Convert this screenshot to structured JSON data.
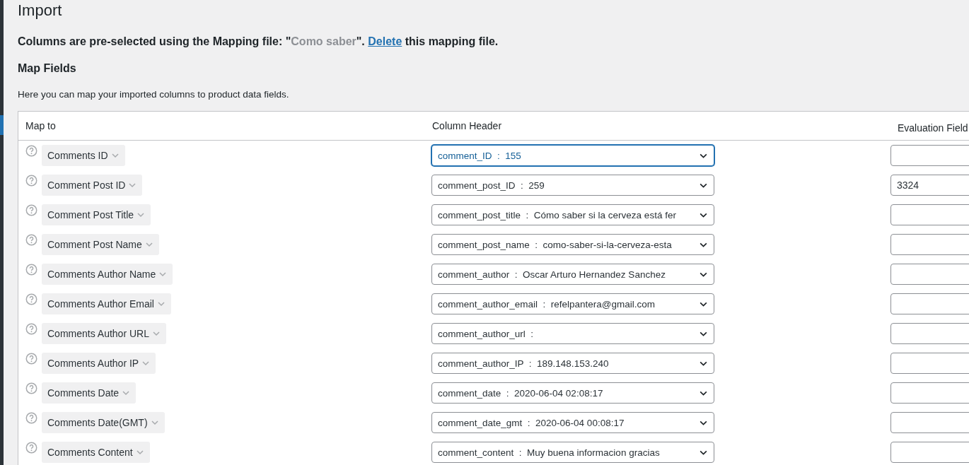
{
  "page_title": "Import",
  "notice": {
    "before": "Columns are pre-selected using the Mapping file: \"",
    "file_name": "Como saber",
    "middle": "\". ",
    "link": "Delete",
    "after": " this mapping file."
  },
  "section_title": "Map Fields",
  "description": "Here you can map your imported columns to product data fields.",
  "table": {
    "columns": [
      "Map to",
      "Column Header",
      "Evaluation Field"
    ],
    "rows": [
      {
        "map_to": "Comments ID",
        "column_header": "comment_ID  :  155",
        "evaluation": "",
        "focused": true
      },
      {
        "map_to": "Comment Post ID",
        "column_header": "comment_post_ID  :  259",
        "evaluation": "3324",
        "focused": false
      },
      {
        "map_to": "Comment Post Title",
        "column_header": "comment_post_title  :  Cómo saber si la cerveza está fer",
        "evaluation": "",
        "focused": false
      },
      {
        "map_to": "Comment Post Name",
        "column_header": "comment_post_name  :  como-saber-si-la-cerveza-esta",
        "evaluation": "",
        "focused": false
      },
      {
        "map_to": "Comments Author Name",
        "column_header": "comment_author  :  Oscar Arturo Hernandez Sanchez",
        "evaluation": "",
        "focused": false
      },
      {
        "map_to": "Comments Author Email",
        "column_header": "comment_author_email  :  refelpantera@gmail.com",
        "evaluation": "",
        "focused": false
      },
      {
        "map_to": "Comments Author URL",
        "column_header": "comment_author_url  :",
        "evaluation": "",
        "focused": false
      },
      {
        "map_to": "Comments Author IP",
        "column_header": "comment_author_IP  :  189.148.153.240",
        "evaluation": "",
        "focused": false
      },
      {
        "map_to": "Comments Date",
        "column_header": "comment_date  :  2020-06-04 02:08:17",
        "evaluation": "",
        "focused": false
      },
      {
        "map_to": "Comments Date(GMT)",
        "column_header": "comment_date_gmt  :  2020-06-04 00:08:17",
        "evaluation": "",
        "focused": false
      },
      {
        "map_to": "Comments Content",
        "column_header": "comment_content  :  Muy buena informacion gracias",
        "evaluation": "",
        "focused": false
      }
    ]
  }
}
